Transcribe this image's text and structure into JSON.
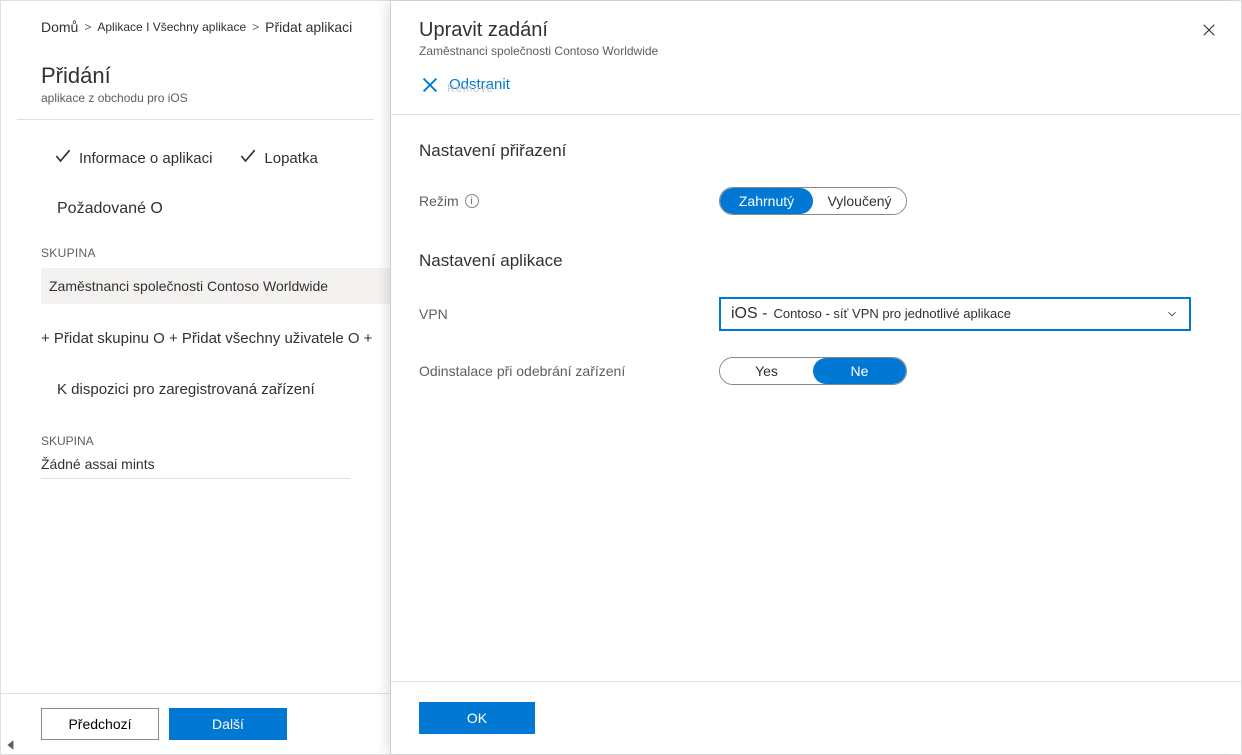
{
  "breadcrumb": {
    "home": "Domů",
    "gt1": ">",
    "apps": "Aplikace I Všechny aplikace",
    "gt2": ">",
    "add": "Přidat aplikaci"
  },
  "blade": {
    "title": "Přidání",
    "subtitle": "aplikace z obchodu pro iOS"
  },
  "wizard": {
    "step1": "Informace o aplikaci",
    "step2": "Lopatka"
  },
  "sections": {
    "required": "Požadované O",
    "group_label": "SKUPINA",
    "group_value": "Zaměstnanci společnosti Contoso Worldwide",
    "add_line": "+ Přidat skupinu O + Přidat všechny uživatele O +",
    "available": "K dispozici pro zaregistrovaná zařízení",
    "group_label2": "SKUPINA",
    "empty": "Žádné assai mints"
  },
  "footer": {
    "prev": "Předchozí",
    "next": "Další"
  },
  "flyout": {
    "title": "Upravit zadání",
    "subtitle": "Zaměstnanci společnosti Contoso Worldwide",
    "remove": "Odstranit",
    "remove_ghost": "Remove",
    "heading_assignment": "Nastavení přiřazení",
    "label_mode": "Režim",
    "mode_included": "Zahrnutý",
    "mode_excluded": "Vyloučený",
    "heading_app": "Nastavení aplikace",
    "label_vpn": "VPN",
    "vpn_prefix": "iOS -",
    "vpn_rest": "Contoso - síť VPN pro jednotlivé aplikace",
    "label_uninstall": "Odinstalace při odebrání zařízení",
    "yes": "Yes",
    "no": "Ne",
    "ok": "OK"
  }
}
